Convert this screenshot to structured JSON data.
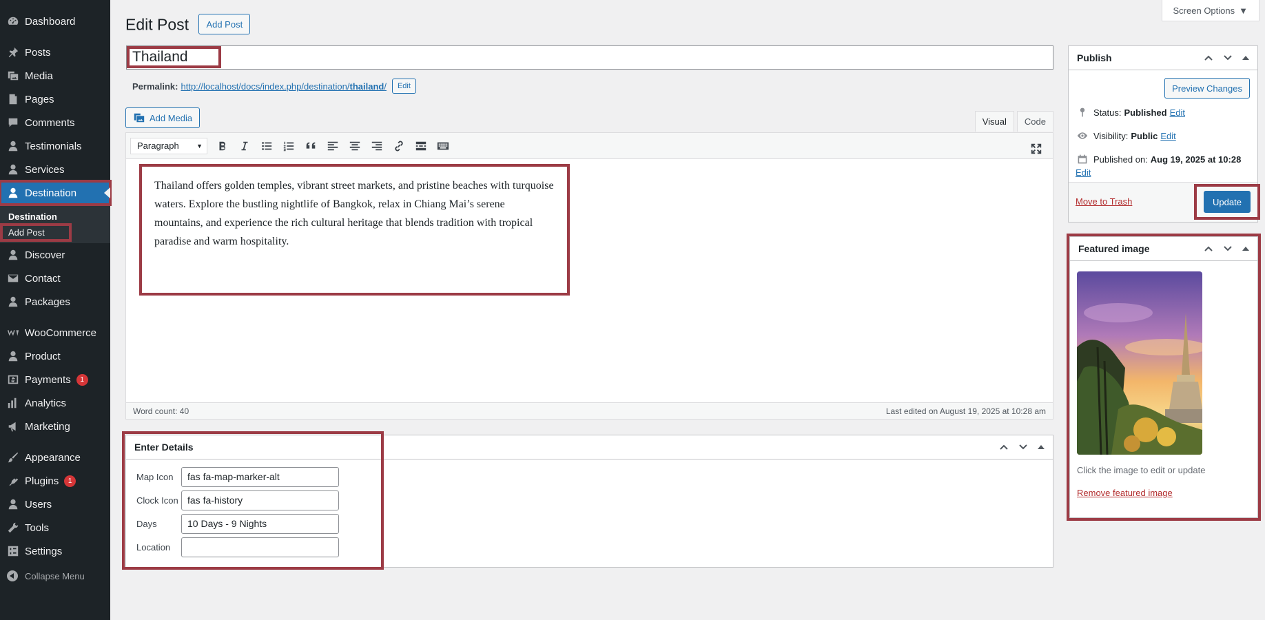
{
  "sidebar": {
    "items": [
      {
        "label": "Dashboard",
        "icon": "dashboard-icon"
      },
      {
        "label": "Posts",
        "icon": "pin-icon"
      },
      {
        "label": "Media",
        "icon": "media-icon"
      },
      {
        "label": "Pages",
        "icon": "pages-icon"
      },
      {
        "label": "Comments",
        "icon": "comments-icon"
      },
      {
        "label": "Testimonials",
        "icon": "user-icon"
      },
      {
        "label": "Services",
        "icon": "user-icon"
      },
      {
        "label": "Destination",
        "icon": "user-icon"
      },
      {
        "label": "Discover",
        "icon": "user-icon"
      },
      {
        "label": "Contact",
        "icon": "mail-icon"
      },
      {
        "label": "Packages",
        "icon": "user-icon"
      },
      {
        "label": "WooCommerce",
        "icon": "woocommerce-icon"
      },
      {
        "label": "Product",
        "icon": "user-icon"
      },
      {
        "label": "Payments",
        "icon": "payments-icon",
        "badge": "1"
      },
      {
        "label": "Analytics",
        "icon": "analytics-icon"
      },
      {
        "label": "Marketing",
        "icon": "megaphone-icon"
      },
      {
        "label": "Appearance",
        "icon": "paintbrush-icon"
      },
      {
        "label": "Plugins",
        "icon": "plugin-icon",
        "badge": "1"
      },
      {
        "label": "Users",
        "icon": "user-icon"
      },
      {
        "label": "Tools",
        "icon": "wrench-icon"
      },
      {
        "label": "Settings",
        "icon": "settings-icon"
      }
    ],
    "submenu": {
      "heading": "Destination",
      "item": "Add Post"
    },
    "collapse_label": "Collapse Menu"
  },
  "header": {
    "screen_options": "Screen Options",
    "page_title": "Edit Post",
    "add_post_button": "Add Post"
  },
  "post": {
    "title": "Thailand",
    "permalink_label": "Permalink:",
    "permalink_base": "http://localhost/docs/index.php/destination/",
    "permalink_slug": "thailand",
    "permalink_end": "/",
    "permalink_edit": "Edit"
  },
  "editor": {
    "add_media": "Add Media",
    "tab_visual": "Visual",
    "tab_code": "Code",
    "format": "Paragraph",
    "content": "Thailand offers golden temples, vibrant street markets, and pristine beaches with turquoise waters. Explore the bustling nightlife of Bangkok, relax in Chiang Mai’s serene mountains, and experience the rich cultural heritage that blends tradition with tropical paradise and warm hospitality.",
    "word_count": "Word count: 40",
    "last_edited": "Last edited on August 19, 2025 at 10:28 am"
  },
  "details": {
    "title": "Enter Details",
    "fields": [
      {
        "label": "Map Icon",
        "value": "fas fa-map-marker-alt"
      },
      {
        "label": "Clock Icon",
        "value": "fas fa-history"
      },
      {
        "label": "Days",
        "value": "10 Days - 9 Nights"
      },
      {
        "label": "Location",
        "value": ""
      }
    ]
  },
  "publish": {
    "title": "Publish",
    "preview": "Preview Changes",
    "status_label": "Status:",
    "status_value": "Published",
    "visibility_label": "Visibility:",
    "visibility_value": "Public",
    "published_label": "Published on:",
    "published_value": "Aug 19, 2025 at 10:28",
    "edit": "Edit",
    "trash": "Move to Trash",
    "update": "Update"
  },
  "featured": {
    "title": "Featured image",
    "caption": "Click the image to edit or update",
    "remove": "Remove featured image"
  },
  "colors": {
    "sidebar_bg": "#1d2327",
    "accent": "#2271b1",
    "highlight": "#9c3b45",
    "danger": "#b32d2e"
  }
}
